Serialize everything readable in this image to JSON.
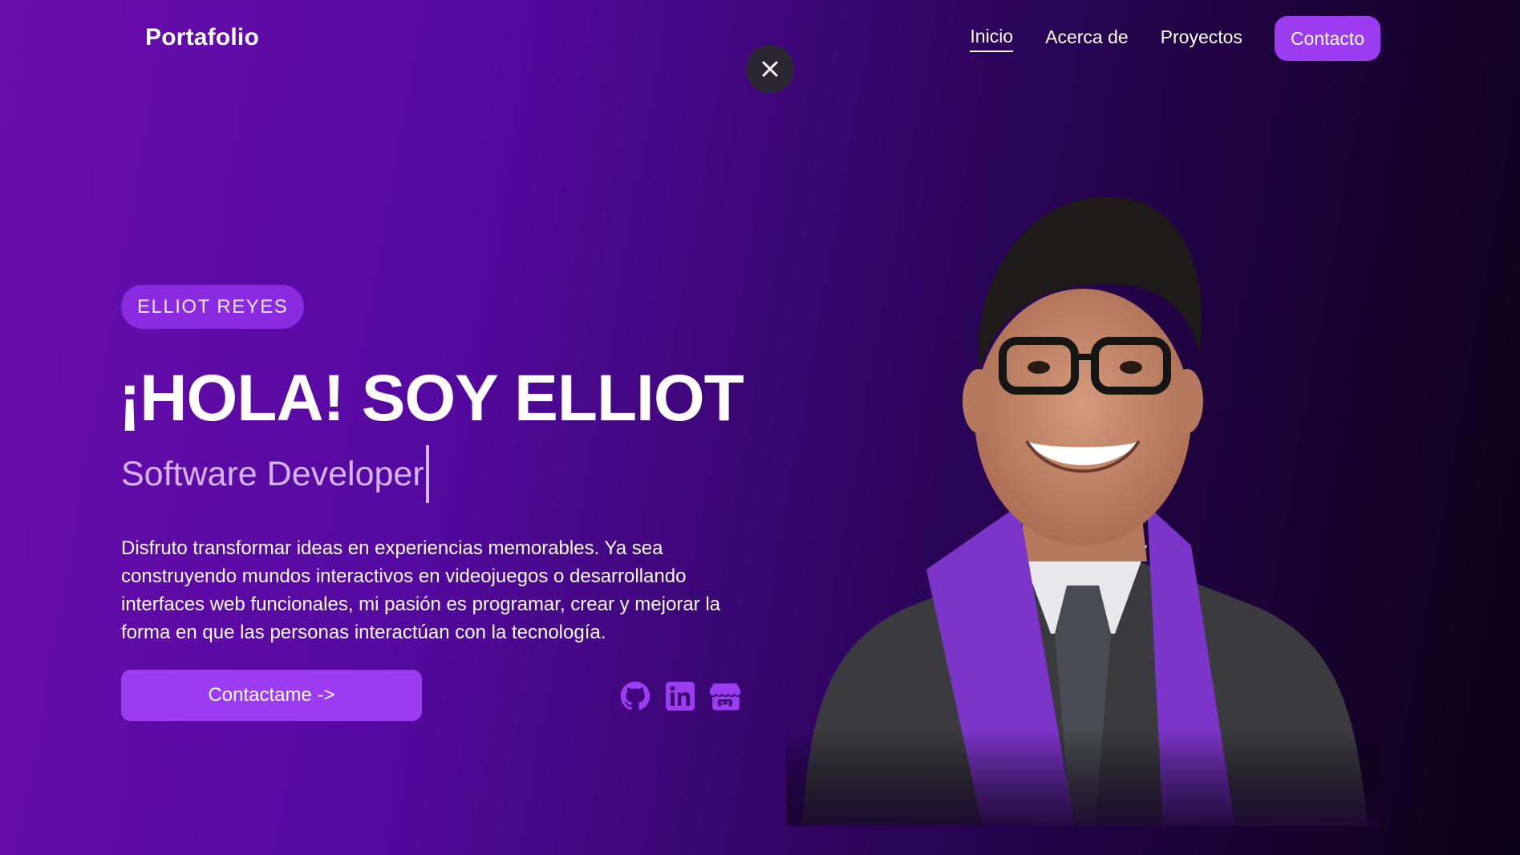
{
  "nav": {
    "brand": "Portafolio",
    "links": [
      {
        "label": "Inicio",
        "active": true
      },
      {
        "label": "Acerca de",
        "active": false
      },
      {
        "label": "Proyectos",
        "active": false
      }
    ],
    "cta_label": "Contacto"
  },
  "hero": {
    "badge": "ELLIOT REYES",
    "title": "¡HOLA! SOY ELLIOT",
    "subtitle": "Software Developer",
    "description": "Disfruto transformar ideas en experiencias memorables. Ya sea construyendo mundos interactivos en videojuegos o desarrollando interfaces web funcionales, mi pasión es programar, crear y mejorar la forma en que las personas interactúan con la tecnología.",
    "cta_label": "Contactame ->"
  },
  "socials": [
    "github-icon",
    "linkedin-icon",
    "itch-io-icon"
  ],
  "colors": {
    "accent": "#9b3cf0",
    "badge": "#8a2be2",
    "subtitle": "#d6b4ff",
    "bg_start": "#6a0dad",
    "bg_end": "#0b0114"
  }
}
